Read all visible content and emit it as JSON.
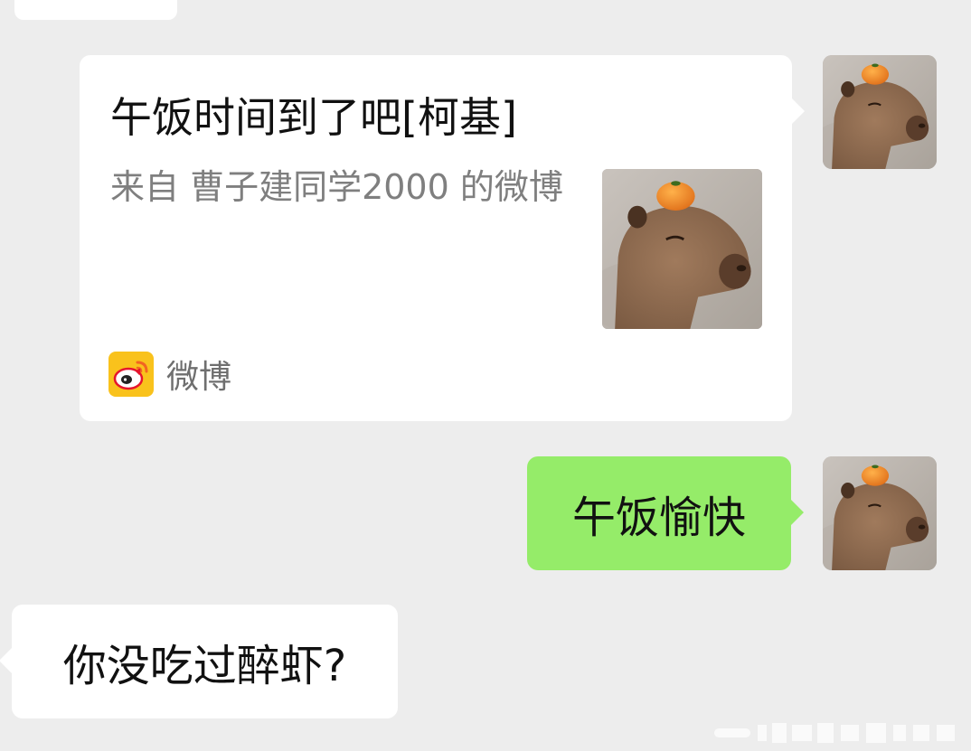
{
  "chat": {
    "card": {
      "title": "午饭时间到了吧[柯基]",
      "description": "来自 曹子建同学2000 的微博",
      "source_label": "微博",
      "source_icon": "weibo-logo-icon",
      "thumbnail": "capybara-with-orange-image"
    },
    "sent_message": "午饭愉快",
    "received_message": "你没吃过醉虾?",
    "my_avatar": "capybara-with-orange-avatar"
  },
  "colors": {
    "background": "#ededed",
    "sent_bubble": "#95ec69",
    "received_bubble": "#ffffff",
    "secondary_text": "#7f7f7f"
  }
}
